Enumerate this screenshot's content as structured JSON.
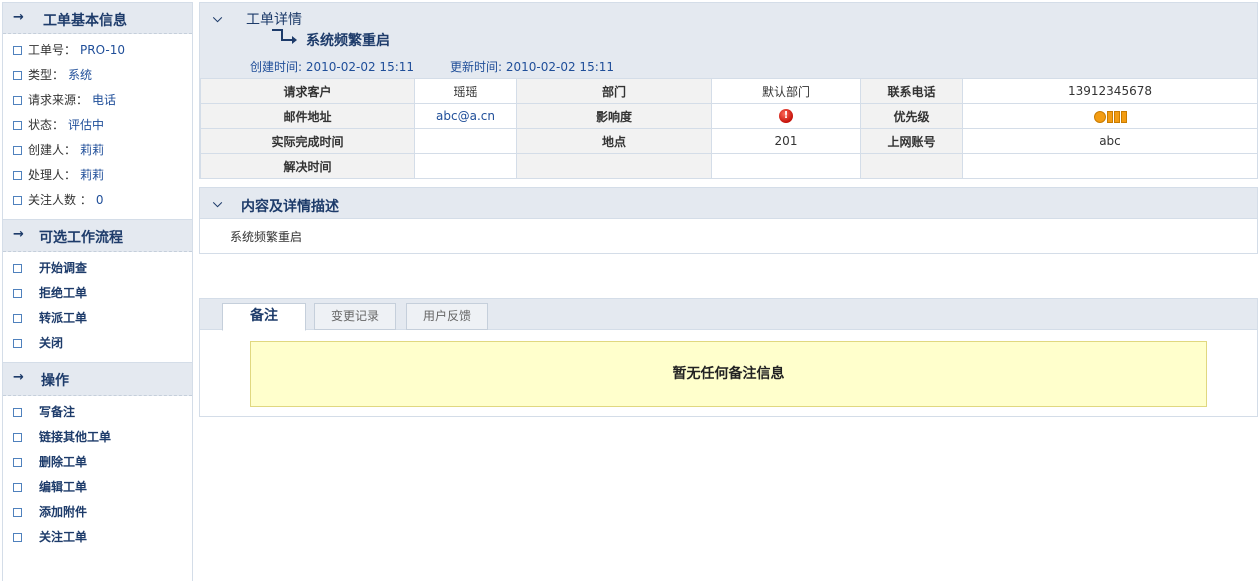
{
  "sidebar": {
    "basic": {
      "title": "工单基本信息",
      "items": [
        {
          "key": "工单号：",
          "value": "PRO-10"
        },
        {
          "key": "类型：",
          "value": "系统"
        },
        {
          "key": "请求来源：",
          "value": "电话"
        },
        {
          "key": "状态：",
          "value": "评估中"
        },
        {
          "key": "创建人：",
          "value": "莉莉"
        },
        {
          "key": "处理人：",
          "value": "莉莉"
        },
        {
          "key": "关注人数 ：",
          "value": "0"
        }
      ]
    },
    "workflow": {
      "title": "可选工作流程",
      "items": [
        "开始调查",
        "拒绝工单",
        "转派工单",
        "关闭"
      ]
    },
    "operations": {
      "title": "操作",
      "items": [
        "写备注",
        "链接其他工单",
        "删除工单",
        "编辑工单",
        "添加附件",
        "关注工单"
      ]
    }
  },
  "detail": {
    "title": "工单详情",
    "subject": "系统频繁重启",
    "created_label": "创建时间:",
    "created_value": "2010-02-02 15:11",
    "updated_label": "更新时间:",
    "updated_value": "2010-02-02 15:11",
    "table": {
      "row1": {
        "l1": "请求客户",
        "v1": "瑶瑶",
        "l2": "部门",
        "v2": "默认部门",
        "l3": "联系电话",
        "v3": "13912345678"
      },
      "row2": {
        "l1": "邮件地址",
        "v1": "abc@a.cn",
        "l2": "影响度",
        "v2_icon": "red-alert-icon",
        "l3": "优先级",
        "v3_icon": "priority-level-icon"
      },
      "row3": {
        "l1": "实际完成时间",
        "v1": "",
        "l2": "地点",
        "v2": "201",
        "l3": "上网账号",
        "v3": "abc"
      },
      "row4": {
        "l1": "解决时间",
        "v1": "",
        "l2": "",
        "v2": "",
        "l3": "",
        "v3": ""
      }
    }
  },
  "content": {
    "title": "内容及详情描述",
    "body": "系统频繁重启"
  },
  "tabs": {
    "items": [
      "备注",
      "变更记录",
      "用户反馈"
    ],
    "active": "备注",
    "empty_notice": "暂无任何备注信息"
  },
  "colors": {
    "header_bg": "#e4e9f0",
    "title": "#1d3b6a",
    "link": "#1f4e99",
    "notice_bg": "#ffffcc"
  }
}
